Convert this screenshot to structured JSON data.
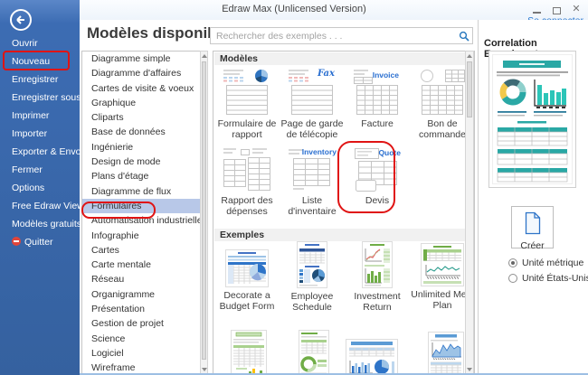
{
  "titlebar": {
    "title": "Edraw Max (Unlicensed Version)"
  },
  "account": {
    "sign_in": "Se connecter"
  },
  "sidebar": {
    "items": [
      "Ouvrir",
      "Nouveau",
      "Enregistrer",
      "Enregistrer sous",
      "Imprimer",
      "Importer",
      "Exporter & Envoyer",
      "Fermer",
      "Options",
      "Free Edraw Viewer",
      "Modèles gratuits...",
      "Quitter"
    ],
    "highlighted": "Nouveau"
  },
  "categories": [
    "Diagramme simple",
    "Diagramme d'affaires",
    "Cartes de visite & voeux",
    "Graphique",
    "Cliparts",
    "Base de données",
    "Ingénierie",
    "Design de mode",
    "Plans d'étage",
    "Diagramme de flux",
    "Formulaires",
    "Automatisation industrielle",
    "Infographie",
    "Cartes",
    "Carte mentale",
    "Réseau",
    "Organigramme",
    "Présentation",
    "Gestion de projet",
    "Science",
    "Logiciel",
    "Wireframe"
  ],
  "main": {
    "heading": "Modèles disponibles",
    "search_placeholder": "Rechercher des exemples . . .",
    "templates_header": "Modèles",
    "examples_header": "Exemples",
    "templates": [
      {
        "label": "Formulaire de rapport"
      },
      {
        "label": "Page de garde de télécopie",
        "badge": "Fax"
      },
      {
        "label": "Facture",
        "badge": "Invoice"
      },
      {
        "label": "Bon de commande"
      },
      {
        "label": "Rapport des dépenses"
      },
      {
        "label": "Liste d'inventaire",
        "badge": "Inventory"
      },
      {
        "label": "Devis",
        "badge": "Quote",
        "highlighted": true
      }
    ],
    "examples": [
      {
        "label": "Decorate a Budget Form"
      },
      {
        "label": "Employee Schedule"
      },
      {
        "label": "Investment Return"
      },
      {
        "label": "Unlimited Meal Plan"
      }
    ]
  },
  "preview": {
    "title": "Correlation Experiment"
  },
  "actions": {
    "create": "Créer"
  },
  "units": [
    {
      "label": "Unité métrique",
      "selected": true
    },
    {
      "label": "Unité États-Unis",
      "selected": false
    }
  ],
  "colors": {
    "sidebar_blue": "#3a6ab2",
    "link_blue": "#2b79d0",
    "annotation_red": "#e01414",
    "badge_blue": "#2a6fd0",
    "preview_teal": "#2aa8a5"
  }
}
